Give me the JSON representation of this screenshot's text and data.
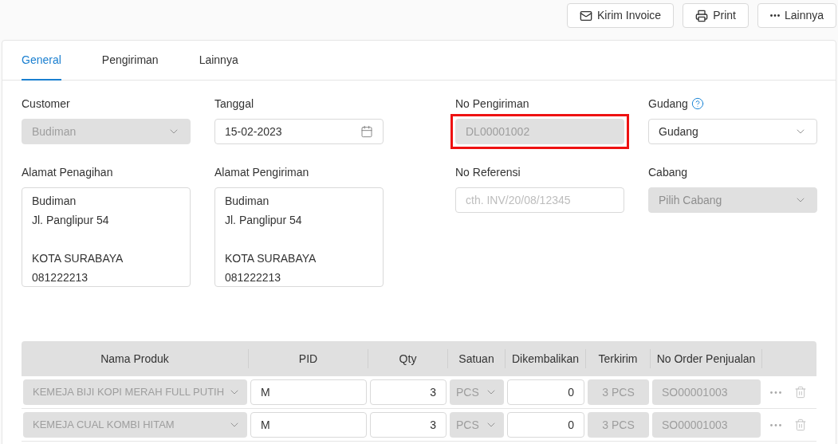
{
  "toolbar": {
    "buttons": [
      {
        "label": "Kirim Invoice",
        "kind": "mail"
      },
      {
        "label": "Print",
        "kind": "print"
      },
      {
        "label": "Lainnya",
        "kind": "more"
      }
    ]
  },
  "tabs": [
    {
      "label": "General",
      "selected": true
    },
    {
      "label": "Pengiriman",
      "selected": false
    },
    {
      "label": "Lainnya",
      "selected": false
    }
  ],
  "form_rows": [
    [
      {
        "kind": "select",
        "label": "Customer",
        "value": "Budiman",
        "disabled": true
      },
      {
        "kind": "date",
        "label": "Tanggal",
        "value": "15-02-2023",
        "disabled": false
      },
      {
        "kind": "text",
        "label": "No Pengiriman",
        "value": "DL00001002",
        "disabled": true,
        "highlighted": true
      },
      {
        "kind": "select",
        "label": "Gudang",
        "value": "Gudang",
        "disabled": false,
        "help": true
      }
    ],
    [
      {
        "kind": "address",
        "label": "Alamat Penagihan",
        "street_lines": [
          "Budiman",
          "Jl. Panglipur 54"
        ],
        "city_lines": [
          "KOTA SURABAYA",
          "081222213"
        ]
      },
      {
        "kind": "address",
        "label": "Alamat Pengiriman",
        "street_lines": [
          "Budiman",
          "Jl. Panglipur 54"
        ],
        "city_lines": [
          "KOTA SURABAYA",
          "081222213"
        ]
      },
      {
        "kind": "text",
        "label": "No Referensi",
        "placeholder": "cth. INV/20/08/12345",
        "disabled": false
      },
      {
        "kind": "select",
        "label": "Cabang",
        "placeholder": "Pilih Cabang",
        "disabled": true
      }
    ]
  ],
  "table": {
    "columns": [
      "Nama Produk",
      "PID",
      "Qty",
      "Satuan",
      "Dikembalikan",
      "Terkirim",
      "No Order Penjualan"
    ],
    "rows": [
      {
        "product": "KEMEJA BIJI KOPI MERAH FULL PUTIH",
        "pid": "M",
        "qty": "3",
        "unit": "PCS",
        "returned": "0",
        "shipped": "3 PCS",
        "order": "SO00001003"
      },
      {
        "product": "KEMEJA CUAL KOMBI HITAM",
        "pid": "M",
        "qty": "3",
        "unit": "PCS",
        "returned": "0",
        "shipped": "3 PCS",
        "order": "SO00001003"
      }
    ]
  }
}
